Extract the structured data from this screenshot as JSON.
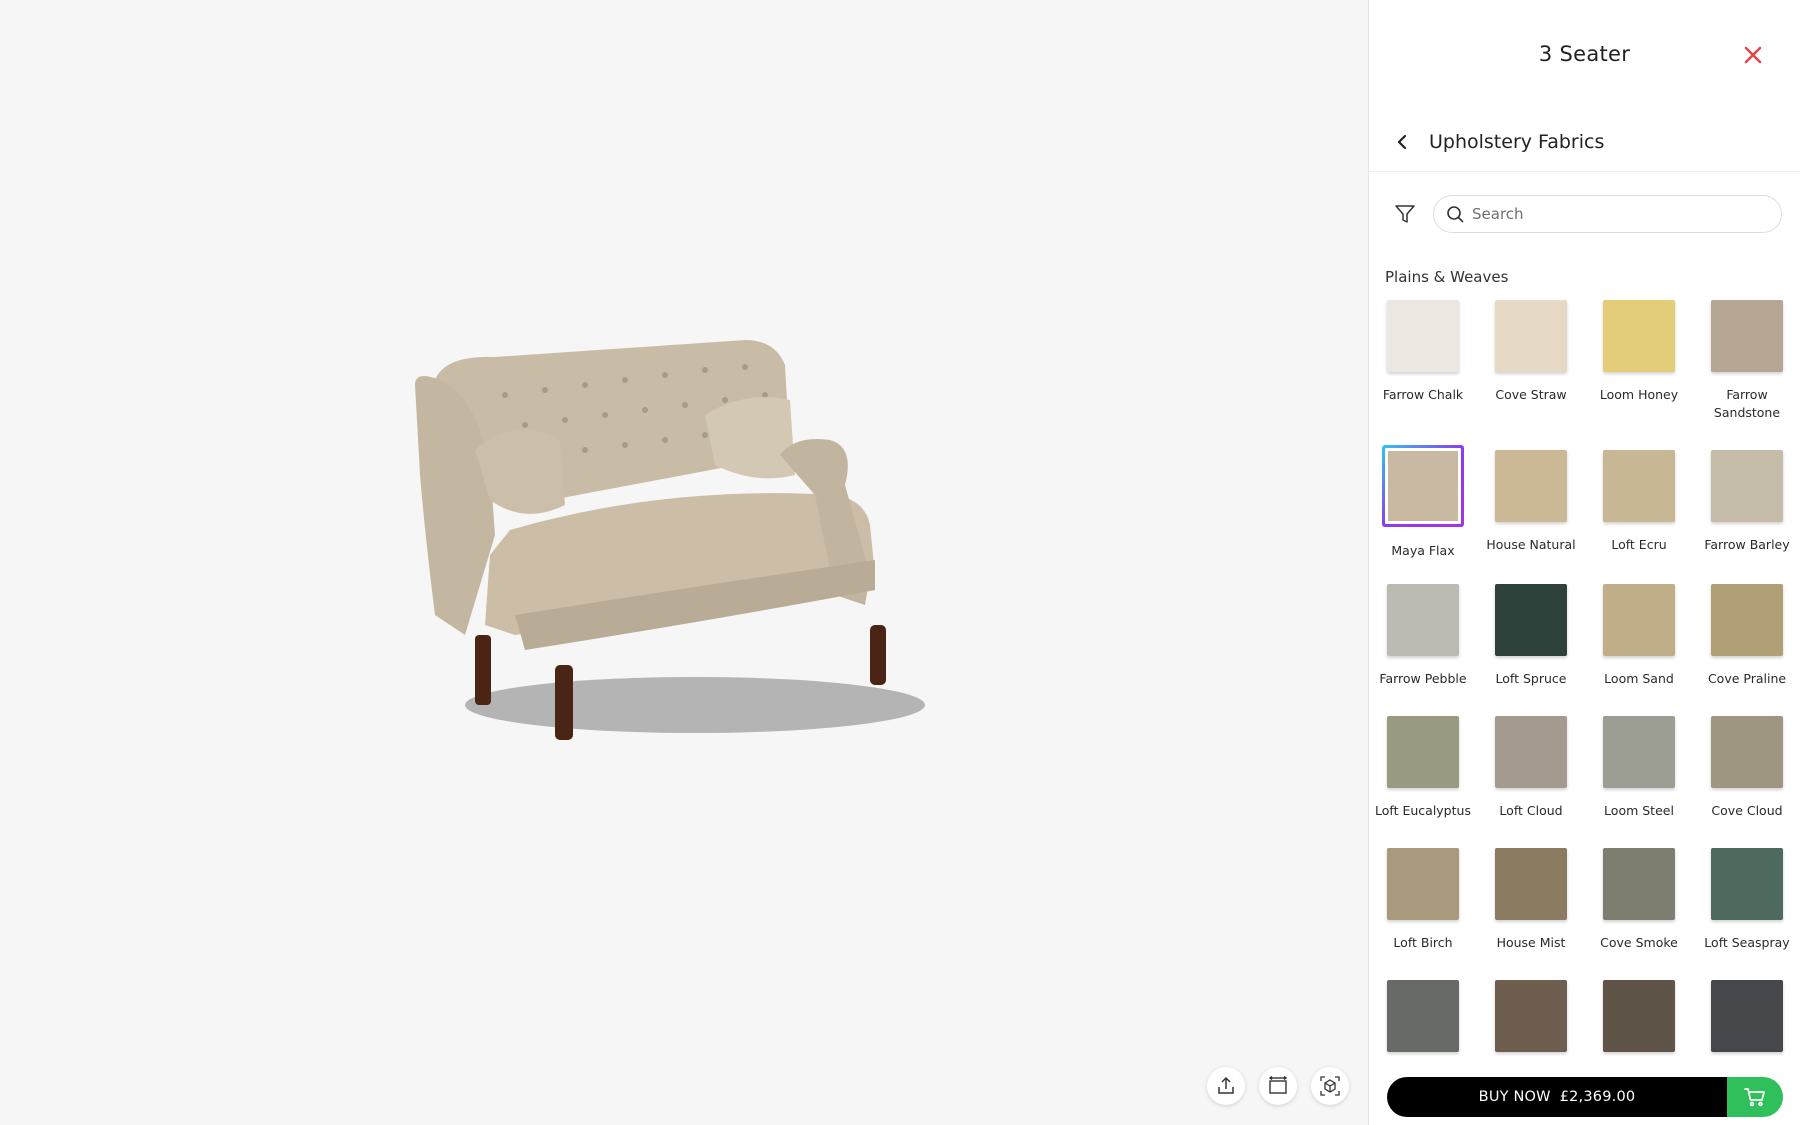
{
  "viewer": {
    "product_image_alt": "Tufted 3 seater sofa",
    "tools": [
      {
        "icon": "share-icon"
      },
      {
        "icon": "dimensions-icon"
      },
      {
        "icon": "ar-view-icon"
      }
    ]
  },
  "panel": {
    "title": "3 Seater",
    "section_title": "Upholstery Fabrics",
    "search_placeholder": "Search",
    "category": "Plains & Weaves",
    "fabrics": [
      {
        "name": "Farrow Chalk",
        "color": "#ede7e1",
        "selected": false
      },
      {
        "name": "Cove Straw",
        "color": "#e6d9c6",
        "selected": false
      },
      {
        "name": "Loom Honey",
        "color": "#e4cd78",
        "selected": false
      },
      {
        "name": "Farrow Sandstone",
        "color": "#b5a794",
        "selected": false
      },
      {
        "name": "Maya Flax",
        "color": "#c9b9a2",
        "selected": true
      },
      {
        "name": "House Natural",
        "color": "#cbb996",
        "selected": false
      },
      {
        "name": "Loft Ecru",
        "color": "#c8b794",
        "selected": false
      },
      {
        "name": "Farrow Barley",
        "color": "#c4bba9",
        "selected": false
      },
      {
        "name": "Farrow Pebble",
        "color": "#bdbab3",
        "selected": false
      },
      {
        "name": "Loft Spruce",
        "color": "#2e413b",
        "selected": false
      },
      {
        "name": "Loom Sand",
        "color": "#bfae88",
        "selected": false
      },
      {
        "name": "Cove Praline",
        "color": "#b09e74",
        "selected": false
      },
      {
        "name": "Loft Eucalyptus",
        "color": "#9a9a82",
        "selected": false
      },
      {
        "name": "Loft Cloud",
        "color": "#a39b8f",
        "selected": false
      },
      {
        "name": "Loom Steel",
        "color": "#9c9d93",
        "selected": false
      },
      {
        "name": "Cove Cloud",
        "color": "#9f9682",
        "selected": false
      },
      {
        "name": "Loft Birch",
        "color": "#a99a7e",
        "selected": false
      },
      {
        "name": "House Mist",
        "color": "#8b7b60",
        "selected": false
      },
      {
        "name": "Cove Smoke",
        "color": "#7f7d6f",
        "selected": false
      },
      {
        "name": "Loft Seaspray",
        "color": "#4e6a5e",
        "selected": false
      },
      {
        "name": "",
        "color": "#686a68",
        "selected": false
      },
      {
        "name": "",
        "color": "#6e5e50",
        "selected": false
      },
      {
        "name": "",
        "color": "#5f5448",
        "selected": false
      },
      {
        "name": "",
        "color": "#45474a",
        "selected": false
      }
    ],
    "buy_label": "BUY NOW",
    "price": "£2,369.00",
    "colors": {
      "cart": "#2fbf5b",
      "close": "#e04848",
      "selected_border": "#8b3cf0"
    }
  }
}
